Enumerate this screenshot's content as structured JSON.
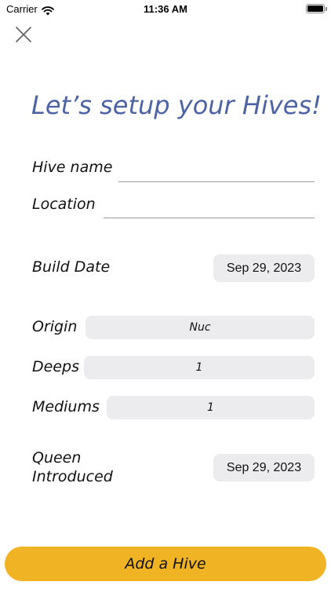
{
  "status_bar": {
    "carrier": "Carrier",
    "time": "11:36 AM"
  },
  "title": "Let’s setup your Hives!",
  "form": {
    "hive_name": {
      "label": "Hive name",
      "value": ""
    },
    "location": {
      "label": "Location",
      "value": ""
    },
    "build_date": {
      "label": "Build Date",
      "value": "Sep 29, 2023"
    },
    "origin": {
      "label": "Origin",
      "value": "Nuc"
    },
    "deeps": {
      "label": "Deeps",
      "value": "1"
    },
    "mediums": {
      "label": "Mediums",
      "value": "1"
    },
    "queen_introduced": {
      "label_line1": "Queen",
      "label_line2": "Introduced",
      "value": "Sep 29, 2023"
    }
  },
  "add_button_label": "Add a Hive",
  "colors": {
    "accent_title": "#4d63a4",
    "button_yellow": "#f0b323",
    "pill_gray": "#ececee"
  },
  "icons": {
    "close": "close-icon",
    "wifi": "wifi-icon",
    "battery": "battery-icon"
  }
}
